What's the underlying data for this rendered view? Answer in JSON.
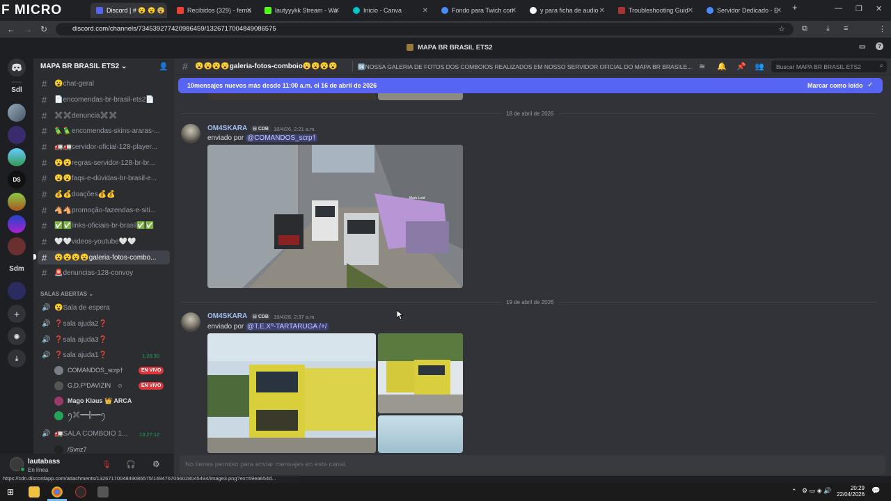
{
  "browser": {
    "watermark": "F MICRO",
    "tabs": [
      {
        "label": "Discord | # 😮 😮 😮 😮 ga",
        "active": true
      },
      {
        "label": "Recibidos (329) - ferna"
      },
      {
        "label": "lautyyykk Stream - Wa"
      },
      {
        "label": "Inicio - Canva"
      },
      {
        "label": "Fondo para Twich con"
      },
      {
        "label": "y para ficha de audio"
      },
      {
        "label": "Troubleshooting Guid"
      },
      {
        "label": "Servidor Dedicado - E"
      }
    ],
    "url": "discord.com/channels/734539277420986459/1326717004849086575"
  },
  "discord": {
    "window_title": "MAPA BR BRASIL ETS2",
    "rail": [
      "Sdl",
      "Sdm"
    ],
    "server_name": "MAPA BR BRASIL ETS2",
    "channels": [
      "😮chat-geral",
      "📄encomendas-br-brasil-ets2📄",
      "✖️✖️denuncia✖️✖️",
      "🦜🦜encomendas-skins-araras-...",
      "🚛🚛servidor-oficial-128-player...",
      "😮😮regras-servidor-128-br-br...",
      "😮😮faqs-e-dúvidas-br-brasil-e...",
      "💰💰doações💰💰",
      "🐴🐴promoção-fazendas-e-siti...",
      "✅✅links-oficiais-br-brasil✅✅",
      "🤍🤍videos-youtube🤍🤍",
      "😮😮😮😮galeria-fotos-combo...",
      "🚨denuncias-128-convoy"
    ],
    "voice_category": "SALAS ABERTAS",
    "voice_channels": [
      {
        "name": "😮Sala de espera"
      },
      {
        "name": "❓sala ajuda2❓"
      },
      {
        "name": "❓sala ajuda3❓"
      },
      {
        "name": "❓sala ajuda1❓",
        "time": "1:26:30"
      }
    ],
    "voice_users": [
      {
        "name": "COMANDOS_scrp†",
        "live": "EN VIVO"
      },
      {
        "name": "G.D.FºDAVIZIN",
        "live": "EN VIVO"
      },
      {
        "name": "Mago Klaus 👑 ARCA"
      },
      {
        "name": "ꪆ✖️━━╬═━ꪆ"
      }
    ],
    "combo_channel": {
      "name": "🚛SALA COMBOIO 1...",
      "time": "13:27:12"
    },
    "combo_user": "/Svnz7",
    "user": {
      "name": "lautabass",
      "status": "En línea"
    },
    "channel_header": {
      "name": "😮😮😮😮galeria-fotos-comboio😮😮😮😮",
      "topic": "🆗NOSSA GALERIA DE FOTOS DOS COMBOIOS REALIZADOS EM NOSSO SERVIDOR OFICIAL DO MAPA BR BRASILE...",
      "search_placeholder": "Buscar MAPA BR BRASIL ETS2"
    },
    "new_messages": {
      "text": "10mensajes nuevos más desde 11:00 a.m. el 16 de abril de 2026",
      "mark_read": "Marcar como leído"
    },
    "messages": [
      {
        "date": "18 de abril de 2026",
        "author": "OM4SKARA",
        "tag": "CDB",
        "time": "18/4/26, 2:21 a.m.",
        "text": "enviado por ",
        "mention": "@COMANDOS_scrp†",
        "photo_labels": [
          "Mark Lord"
        ]
      },
      {
        "date": "19 de abril de 2026",
        "author": "OM4SKARA",
        "tag": "CDB",
        "time": "19/4/26, 2:37 a.m.",
        "text": "enviado por ",
        "mention": "@T.E.Xº-TARTARUGA /+/"
      }
    ],
    "composer_placeholder": "No tienes permiso para enviar mensajes en este canal."
  },
  "status_url": "https://cdn.discordapp.com/attachments/1326717004849086575/1494767056028045494/image3.png?ex=69ea654d...",
  "taskbar": {
    "time": "20:29",
    "date": "22/04/2026"
  }
}
